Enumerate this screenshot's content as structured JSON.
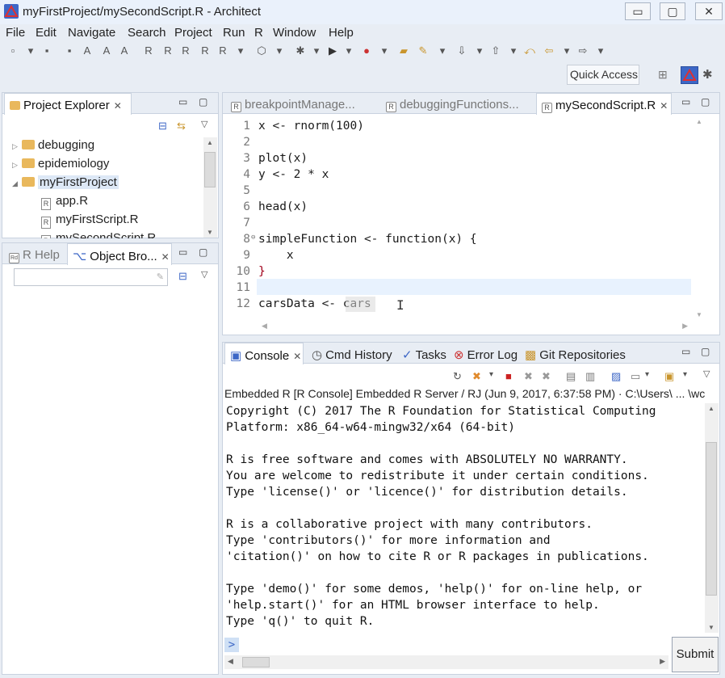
{
  "window": {
    "title": "myFirstProject/mySecondScript.R - Architect",
    "minimize": "▭",
    "restore": "▢",
    "close": "✕"
  },
  "menu": [
    "File",
    "Edit",
    "Navigate",
    "Search",
    "Project",
    "Run",
    "R",
    "Window",
    "Help"
  ],
  "quick_access": "Quick Access",
  "project_explorer": {
    "tab": "Project Explorer",
    "items": [
      {
        "label": "debugging",
        "type": "folder",
        "expanded": false
      },
      {
        "label": "epidemiology",
        "type": "folder",
        "expanded": false
      },
      {
        "label": "myFirstProject",
        "type": "folder",
        "expanded": true
      },
      {
        "label": "app.R",
        "type": "file"
      },
      {
        "label": "myFirstScript.R",
        "type": "file"
      },
      {
        "label": "mySecondScript.R",
        "type": "file"
      }
    ]
  },
  "help_tabs": {
    "r_help": "R Help",
    "object_browser": "Object Bro..."
  },
  "editor": {
    "tabs": [
      "breakpointManage...",
      "debuggingFunctions...",
      "mySecondScript.R"
    ],
    "lines": [
      {
        "n": "1",
        "text": "x <- rnorm(100)"
      },
      {
        "n": "2",
        "text": ""
      },
      {
        "n": "3",
        "text": "plot(x)"
      },
      {
        "n": "4",
        "text": "y <- 2 * x"
      },
      {
        "n": "5",
        "text": ""
      },
      {
        "n": "6",
        "text": "head(x)"
      },
      {
        "n": "7",
        "text": ""
      },
      {
        "n": "8",
        "text": "simpleFunction <- function(x) {"
      },
      {
        "n": "9",
        "text": "    x"
      },
      {
        "n": "10",
        "text": "}"
      },
      {
        "n": "11",
        "text": ""
      },
      {
        "n": "12",
        "text": "carsData <- cars"
      }
    ]
  },
  "bottom_tabs": {
    "console": "Console",
    "cmd_history": "Cmd History",
    "tasks": "Tasks",
    "error_log": "Error Log",
    "git": "Git Repositories"
  },
  "console": {
    "header": "Embedded R [R Console] Embedded R Server / RJ (Jun 9, 2017, 6:37:58 PM)  ·  C:\\Users\\ ... \\wc",
    "lines": [
      "Copyright (C) 2017 The R Foundation for Statistical Computing",
      "Platform: x86_64-w64-mingw32/x64 (64-bit)",
      "",
      "R is free software and comes with ABSOLUTELY NO WARRANTY.",
      "You are welcome to redistribute it under certain conditions.",
      "Type 'license()' or 'licence()' for distribution details.",
      "",
      "R is a collaborative project with many contributors.",
      "Type 'contributors()' for more information and",
      "'citation()' on how to cite R or R packages in publications.",
      "",
      "Type 'demo()' for some demos, 'help()' for on-line help, or",
      "'help.start()' for an HTML browser interface to help.",
      "Type 'q()' to quit R."
    ],
    "prompt": ">",
    "submit": "Submit"
  }
}
